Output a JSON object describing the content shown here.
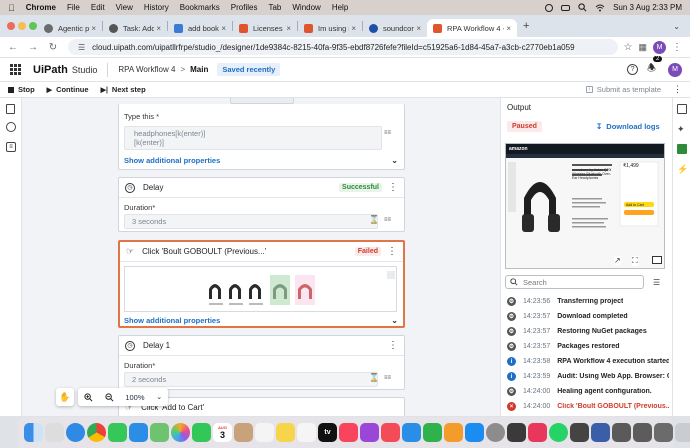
{
  "menubar": {
    "items": [
      "Chrome",
      "File",
      "Edit",
      "View",
      "History",
      "Bookmarks",
      "Profiles",
      "Tab",
      "Window",
      "Help"
    ],
    "datetime": "Sun 3 Aug  2:33 PM"
  },
  "tabs": [
    {
      "label": "Agentic process au",
      "color": "#6b6b6b"
    },
    {
      "label": "Task: Add an authe",
      "color": "#555555"
    },
    {
      "label": "add book - post AP",
      "color": "#3a7bd5"
    },
    {
      "label": "Licenses - Adminis",
      "color": "#e0562c"
    },
    {
      "label": "Im using mac - Age",
      "color": "#e0562c"
    },
    {
      "label": "soundcore by Anke",
      "color": "#1f4fa8"
    },
    {
      "label": "RPA Workflow 4 - ",
      "color": "#e0562c",
      "active": true
    }
  ],
  "address": {
    "url": "cloud.uipath.com/uipatllrfrpe/studio_/designer/1de9384c-8215-40fa-9f35-ebdf8726fefe?fileId=c51925a6-1d84-45a7-a3cb-c2770eb1a059",
    "profile_initial": "M"
  },
  "app": {
    "logo": "UiPath",
    "product": "Studio",
    "project": "RPA Workflow 4",
    "separator": ">",
    "file": "Main",
    "save_status": "Saved recently",
    "notif_count": "2",
    "avatar": "M"
  },
  "debugbar": {
    "stop": "Stop",
    "continue": "Continue",
    "next_step": "Next step",
    "submit_template": "Submit as template"
  },
  "canvas": {
    "type_card": {
      "label": "Type this *",
      "value_line1": "headphones[k(enter)]",
      "value_line2": "[k(enter)]",
      "show_more": "Show additional properties"
    },
    "delay_card": {
      "title": "Delay",
      "status": "Successful",
      "duration_label": "Duration*",
      "duration_value": "3 seconds"
    },
    "click_card": {
      "title": "Click 'Boult GOBOULT (Previous...'",
      "status": "Failed",
      "show_more": "Show additional properties"
    },
    "delay1_card": {
      "title": "Delay 1",
      "duration_label": "Duration*",
      "duration_value": "2 seconds"
    },
    "click_cart_card": {
      "title": "Click 'Add to Cart'"
    },
    "zoom_value": "100%"
  },
  "output": {
    "title": "Output",
    "status": "Paused",
    "download": "Download logs",
    "search_placeholder": "Search",
    "logs": [
      {
        "time": "14:23:56",
        "msg": "Transferring project",
        "kind": "gear"
      },
      {
        "time": "14:23:57",
        "msg": "Download completed",
        "kind": "gear"
      },
      {
        "time": "14:23:57",
        "msg": "Restoring NuGet packages",
        "kind": "gear"
      },
      {
        "time": "14:23:57",
        "msg": "Packages restored",
        "kind": "gear"
      },
      {
        "time": "14:23:58",
        "msg": "RPA Workflow 4 execution started",
        "kind": "info"
      },
      {
        "time": "14:23:59",
        "msg": "Audit: Using Web App. Browser: Chro...",
        "kind": "info"
      },
      {
        "time": "14:24:00",
        "msg": "Healing agent configuration.",
        "kind": "gear"
      },
      {
        "time": "14:24:00",
        "msg": "Click 'Boult GOBOULT (Previous...': Cli...",
        "kind": "error"
      }
    ],
    "preview": {
      "brand": "amazon",
      "price": "₹1,499",
      "product_title": "soundcore by Anker Q20i Wireless Bluetooth Over-Ear Headphones",
      "cta": "Add to Cart"
    }
  },
  "dock": {
    "calendar_month": "AUG",
    "calendar_day": "3",
    "tv_label": "tv"
  },
  "colors": {
    "accent": "#1f6fc5",
    "success": "#2e8b3a",
    "failed": "#d13a2a",
    "selected_border": "#e07548"
  }
}
